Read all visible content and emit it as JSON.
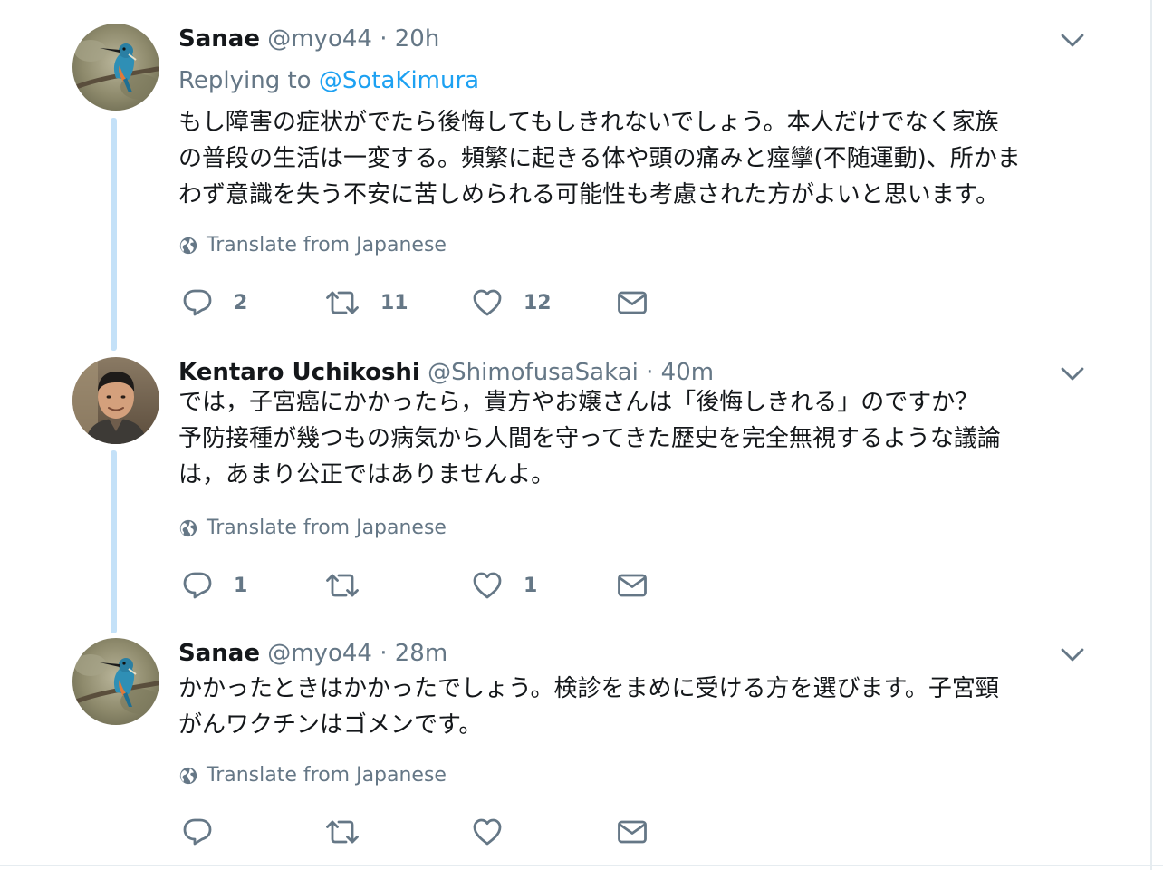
{
  "tweets": [
    {
      "name": "Sanae",
      "handle": "@myo44",
      "separator": "·",
      "time": "20h",
      "replying_prefix": "Replying to",
      "replying_handle": "@SotaKimura",
      "text": "もし障害の症状がでたら後悔してもしきれないでしょう。本人だけでなく家族\nの普段の生活は一変する。頻繁に起きる体や頭の痛みと痙攣(不随運動)、所かま\nわず意識を失う不安に苦しめられる可能性も考慮された方がよいと思います。",
      "translate": "Translate from Japanese",
      "replies": "2",
      "retweets": "11",
      "likes": "12",
      "avatar": "kingfisher-bird-photo"
    },
    {
      "name": "Kentaro Uchikoshi",
      "handle": "@ShimofusaSakai",
      "separator": "·",
      "time": "40m",
      "text": "では，子宮癌にかかったら，貴方やお嬢さんは「後悔しきれる」のですか？\n予防接種が幾つもの病気から人間を守ってきた歴史を完全無視するような議論\nは，あまり公正ではありませんよ。",
      "translate": "Translate from Japanese",
      "replies": "1",
      "retweets": "",
      "likes": "1",
      "avatar": "man-portrait-photo"
    },
    {
      "name": "Sanae",
      "handle": "@myo44",
      "separator": "·",
      "time": "28m",
      "text": "かかったときはかかったでしょう。検診をまめに受ける方を選びます。子宮頸\nがんワクチンはゴメンです。",
      "translate": "Translate from Japanese",
      "replies": "",
      "retweets": "",
      "likes": "",
      "avatar": "kingfisher-bird-photo"
    }
  ],
  "colors": {
    "link": "#1da1f2",
    "secondary_text": "#657786",
    "primary_text": "#14171a",
    "thread_line": "#c4e1f8"
  },
  "icons": {
    "reply": "speech-bubble-icon",
    "retweet": "retweet-arrows-icon",
    "like": "heart-icon",
    "dm": "envelope-icon",
    "menu": "chevron-down-icon",
    "translate": "globe-icon"
  }
}
